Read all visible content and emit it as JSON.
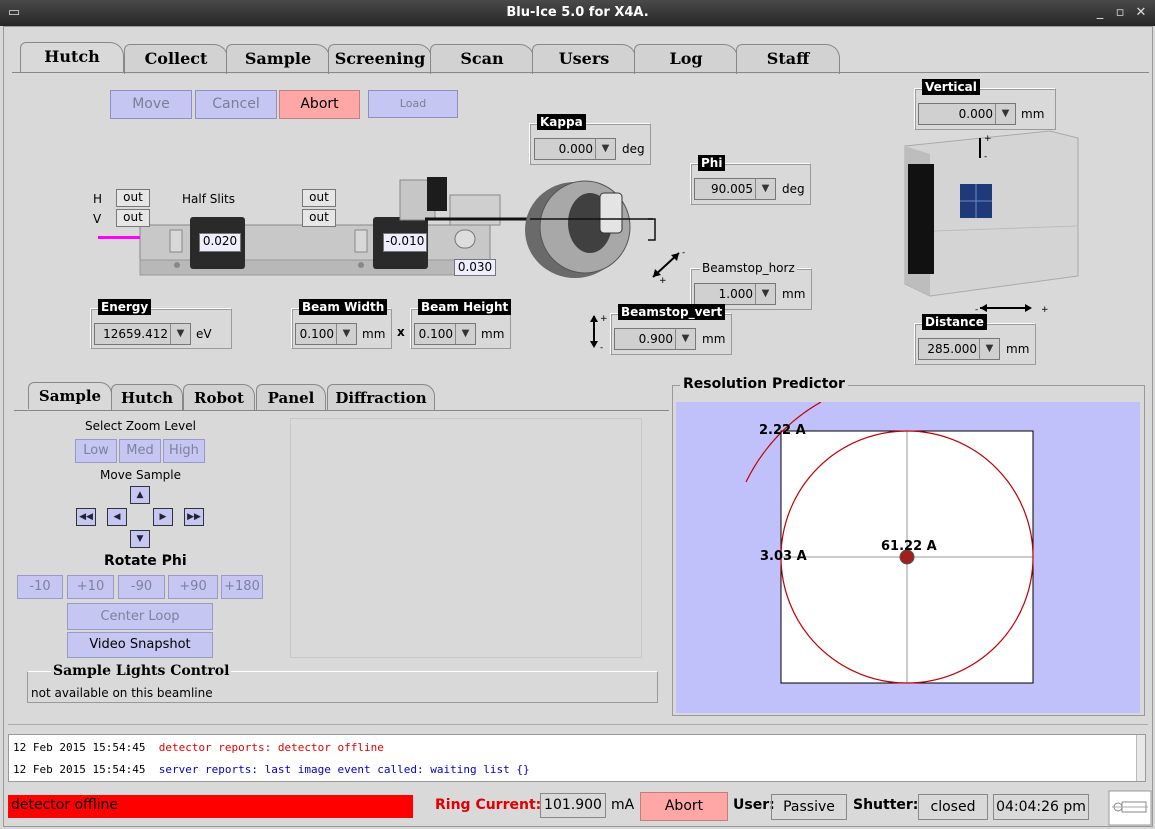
{
  "window": {
    "title": "Blu-Ice 5.0 for X4A."
  },
  "main_tabs": [
    "Hutch",
    "Collect",
    "Sample",
    "Screening",
    "Scan",
    "Users",
    "Log",
    "Staff"
  ],
  "actions": {
    "move": "Move",
    "cancel": "Cancel",
    "abort": "Abort",
    "load": "Load"
  },
  "slits": {
    "h": "H",
    "v": "V",
    "half_slits": "Half Slits",
    "h_left": "out",
    "v_left": "out",
    "h_right": "out",
    "v_right": "out",
    "left_value": "0.020",
    "right_value": "-0.010",
    "gap_value": "0.030"
  },
  "kappa": {
    "label": "Kappa",
    "value": "0.000",
    "unit": "deg"
  },
  "phi": {
    "label": "Phi",
    "value": "90.005",
    "unit": "deg"
  },
  "vertical": {
    "label": "Vertical",
    "value": "0.000",
    "unit": "mm"
  },
  "distance": {
    "label": "Distance",
    "value": "285.000",
    "unit": "mm"
  },
  "beamstop_horz": {
    "label": "Beamstop_horz",
    "value": "1.000",
    "unit": "mm"
  },
  "beamstop_vert": {
    "label": "Beamstop_vert",
    "value": "0.900",
    "unit": "mm"
  },
  "energy": {
    "label": "Energy",
    "value": "12659.412",
    "unit": "eV"
  },
  "beam_width": {
    "label": "Beam Width",
    "value": "0.100",
    "unit": "mm"
  },
  "beam_height": {
    "label": "Beam Height",
    "value": "0.100",
    "unit": "mm"
  },
  "times": "x",
  "lower_tabs": [
    "Sample",
    "Hutch",
    "Robot",
    "Panel",
    "Diffraction"
  ],
  "sample": {
    "zoom_title": "Select Zoom Level",
    "zoom": [
      "Low",
      "Med",
      "High"
    ],
    "move_title": "Move Sample",
    "rotate_title": "Rotate Phi",
    "rotate": [
      "-10",
      "+10",
      "-90",
      "+90",
      "+180"
    ],
    "center_loop": "Center Loop",
    "video_snapshot": "Video Snapshot",
    "lights_title": "Sample Lights Control",
    "lights_text": "not available on this beamline"
  },
  "resolution": {
    "title": "Resolution Predictor",
    "outer": "2.22 A",
    "edge": "3.03 A",
    "center": "61.22 A"
  },
  "log": [
    {
      "time": "12 Feb 2015 15:54:45",
      "msg": "detector reports: detector offline",
      "color": "#e00000"
    },
    {
      "time": "12 Feb 2015 15:54:45",
      "msg": "server reports: last image event called: waiting list {}",
      "color": "#0000d0"
    }
  ],
  "status": {
    "detector": "detector offline",
    "ring_label": "Ring Current:",
    "ring_value": "101.900",
    "ring_unit": "mA",
    "abort": "Abort",
    "user_label": "User:",
    "user_value": "Passive",
    "shutter_label": "Shutter:",
    "shutter_value": "closed",
    "clock": "04:04:26 pm"
  },
  "colors": {
    "accent_blue": "#c6c6f2",
    "abort_red": "#ffa6a6",
    "status_red": "#ff0000",
    "predictor_bg": "#c0c0fa",
    "beam": "#ff00ff"
  }
}
